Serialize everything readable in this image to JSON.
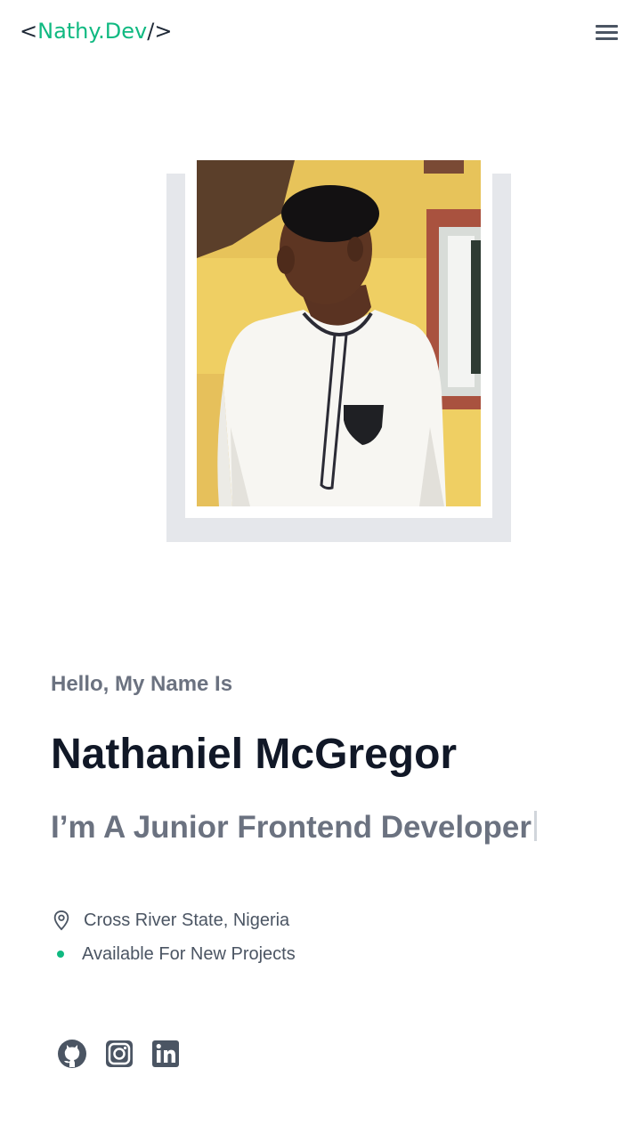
{
  "header": {
    "logo_open": "<",
    "logo_name": "Nathy.Dev",
    "logo_close": "/>",
    "menu_icon": "hamburger-menu-icon"
  },
  "hero": {
    "profile_photo": "portrait-photo",
    "greeting": "Hello, My Name Is",
    "name": "Nathaniel McGregor",
    "role": "I’m A Junior Frontend Developer"
  },
  "info": {
    "location_icon": "map-pin-icon",
    "location": "Cross River State, Nigeria",
    "availability_icon": "green-dot",
    "availability": "Available For New Projects"
  },
  "social": [
    {
      "icon": "github-icon"
    },
    {
      "icon": "instagram-icon"
    },
    {
      "icon": "linkedin-icon"
    }
  ],
  "colors": {
    "accent": "#10b981",
    "heading": "#111827",
    "muted": "#6b7280",
    "frame": "#e5e7eb"
  }
}
